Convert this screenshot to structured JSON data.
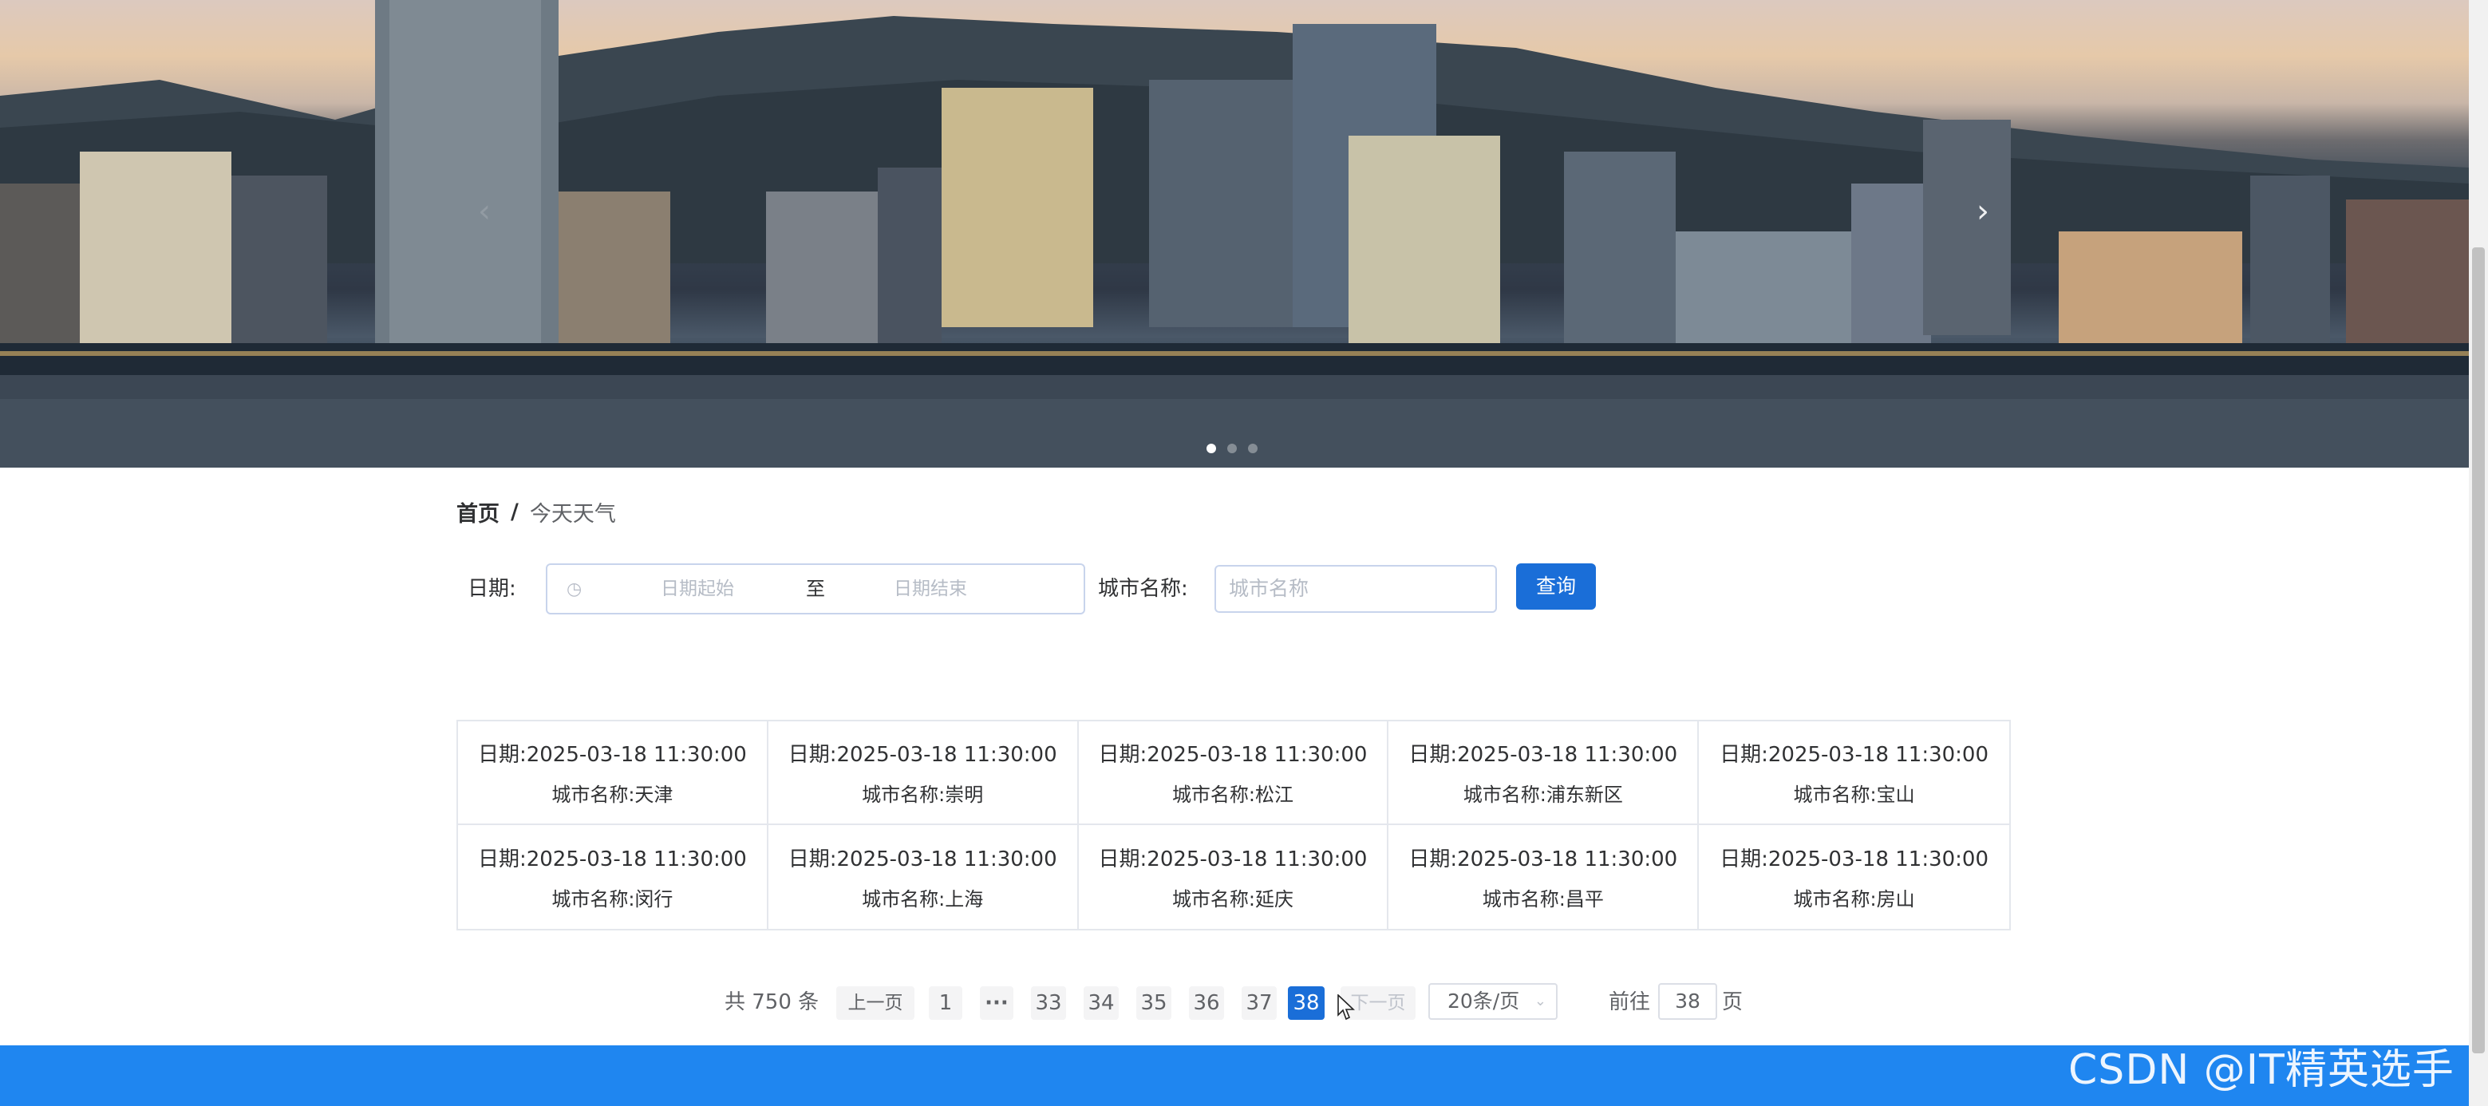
{
  "breadcrumb": {
    "home": "首页",
    "separator": "/",
    "current": "今天天气"
  },
  "search": {
    "date_label": "日期:",
    "date_start_placeholder": "日期起始",
    "date_range_separator": "至",
    "date_end_placeholder": "日期结束",
    "city_label": "城市名称:",
    "city_placeholder": "城市名称",
    "query_button": "查询"
  },
  "cards": [
    {
      "date": "日期:2025-03-18 11:30:00",
      "city": "城市名称:天津"
    },
    {
      "date": "日期:2025-03-18 11:30:00",
      "city": "城市名称:崇明"
    },
    {
      "date": "日期:2025-03-18 11:30:00",
      "city": "城市名称:松江"
    },
    {
      "date": "日期:2025-03-18 11:30:00",
      "city": "城市名称:浦东新区"
    },
    {
      "date": "日期:2025-03-18 11:30:00",
      "city": "城市名称:宝山"
    },
    {
      "date": "日期:2025-03-18 11:30:00",
      "city": "城市名称:闵行"
    },
    {
      "date": "日期:2025-03-18 11:30:00",
      "city": "城市名称:上海"
    },
    {
      "date": "日期:2025-03-18 11:30:00",
      "city": "城市名称:延庆"
    },
    {
      "date": "日期:2025-03-18 11:30:00",
      "city": "城市名称:昌平"
    },
    {
      "date": "日期:2025-03-18 11:30:00",
      "city": "城市名称:房山"
    }
  ],
  "pagination": {
    "total": "共 750 条",
    "prev": "上一页",
    "first": "1",
    "ellipsis": "···",
    "pages": [
      "33",
      "34",
      "35",
      "36",
      "37",
      "38"
    ],
    "current_page": "38",
    "next": "下一页",
    "page_size": "20条/页",
    "goto_prefix": "前往",
    "goto_value": "38",
    "goto_suffix": "页"
  },
  "carousel": {
    "slide_count": 3,
    "active_index": 0
  },
  "watermark": "CSDN @IT精英选手",
  "colors": {
    "primary": "#1a6ed8",
    "footer": "#1f86f0",
    "border": "#e4e7ed"
  }
}
